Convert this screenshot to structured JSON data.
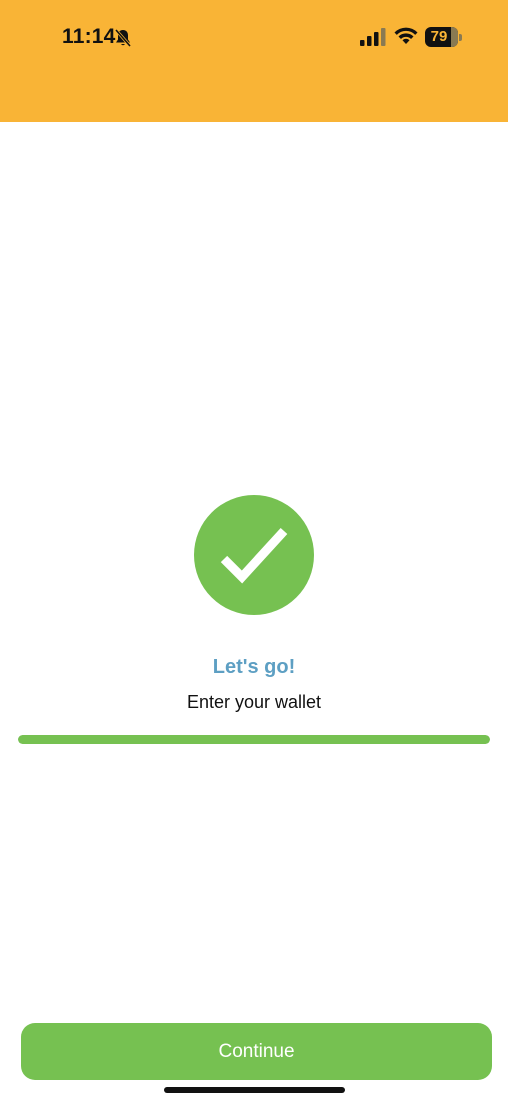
{
  "status_bar": {
    "time": "11:14",
    "battery_level": "79",
    "icons": [
      "bell-slash-icon",
      "cellular-signal-icon",
      "wifi-icon",
      "battery-icon"
    ]
  },
  "colors": {
    "header": "#F9B436",
    "accent_green": "#76C151",
    "title_blue": "#5D9FC3"
  },
  "main": {
    "status_icon": "checkmark-icon",
    "title": "Let's go!",
    "subtitle": "Enter your wallet",
    "progress_fraction": 1.0
  },
  "footer": {
    "continue_label": "Continue"
  }
}
